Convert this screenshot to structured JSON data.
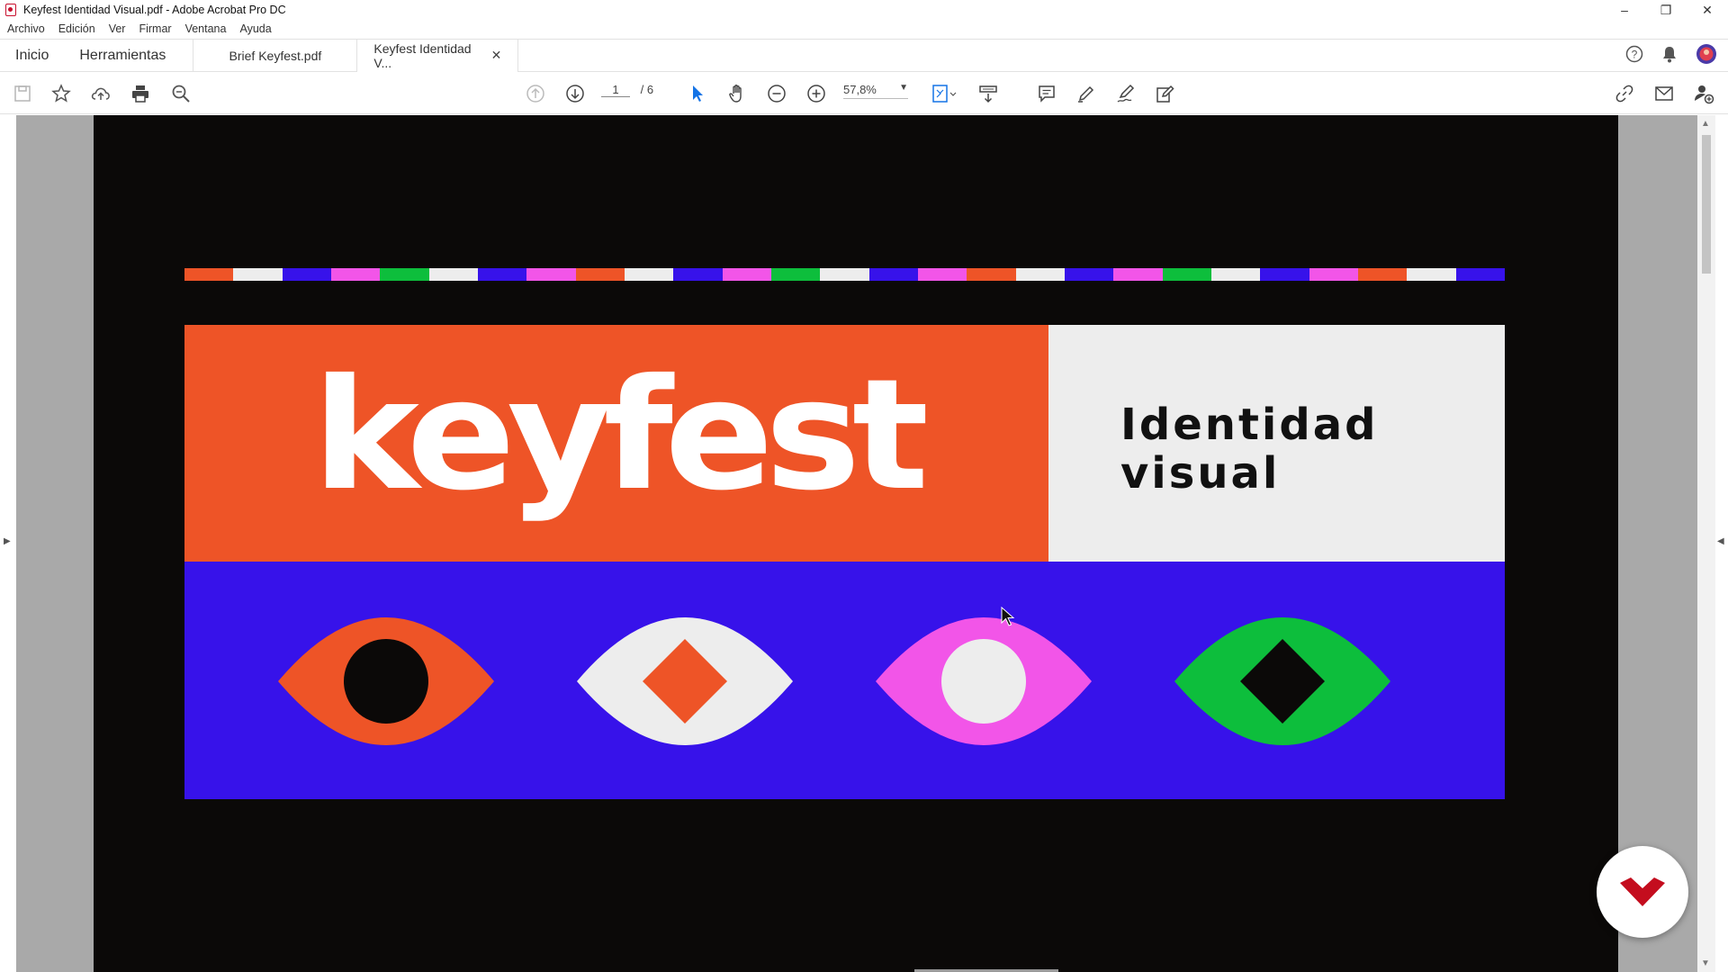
{
  "window": {
    "title": "Keyfest Identidad Visual.pdf - Adobe Acrobat Pro DC"
  },
  "menu": [
    "Archivo",
    "Edición",
    "Ver",
    "Firmar",
    "Ventana",
    "Ayuda"
  ],
  "tabs": {
    "home": "Inicio",
    "tools": "Herramientas",
    "documents": [
      {
        "label": "Brief Keyfest.pdf",
        "active": false
      },
      {
        "label": "Keyfest Identidad V...",
        "active": true
      }
    ]
  },
  "toolbar": {
    "current_page": "1",
    "total_pages": "/ 6",
    "zoom": "57,8%"
  },
  "document": {
    "logo_text": "keyfest",
    "subtitle_line1": "Identidad",
    "subtitle_line2": "visual",
    "colors": {
      "orange": "#ee5427",
      "white": "#ededed",
      "blue": "#3712ea",
      "pink": "#f255e8",
      "green": "#0dbe3c",
      "black": "#0b0908"
    },
    "stripe_pattern": [
      "#ee5427",
      "#ededed",
      "#3712ea",
      "#f255e8",
      "#0dbe3c",
      "#ededed",
      "#3712ea",
      "#f255e8",
      "#ee5427",
      "#ededed",
      "#3712ea",
      "#f255e8",
      "#0dbe3c",
      "#ededed",
      "#3712ea",
      "#f255e8",
      "#ee5427",
      "#ededed",
      "#3712ea",
      "#f255e8",
      "#0dbe3c",
      "#ededed",
      "#3712ea",
      "#f255e8",
      "#ee5427",
      "#ededed",
      "#3712ea"
    ],
    "eyes": [
      {
        "name": "eye-orange",
        "outer": "#ee5427",
        "inner_shape": "circle",
        "inner": "#0b0908"
      },
      {
        "name": "eye-white",
        "outer": "#ededed",
        "inner_shape": "diamond",
        "inner": "#ee5427"
      },
      {
        "name": "eye-pink",
        "outer": "#f255e8",
        "inner_shape": "circle",
        "inner": "#ededed"
      },
      {
        "name": "eye-green",
        "outer": "#0dbe3c",
        "inner_shape": "diamond",
        "inner": "#0b0908"
      }
    ]
  }
}
